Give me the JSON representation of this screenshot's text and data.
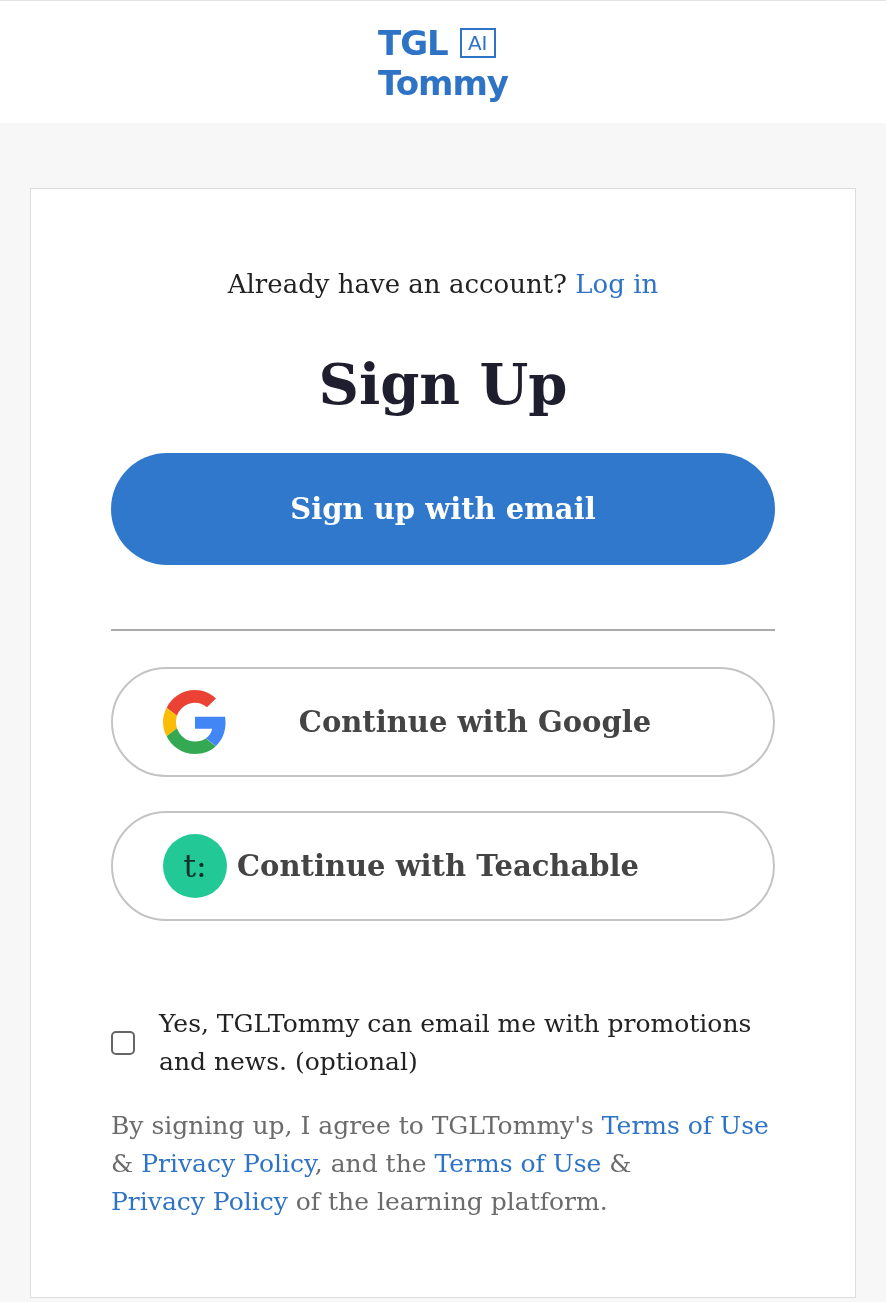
{
  "logo": {
    "line_1": "TGL",
    "chip": "AI",
    "line_2": "Tommy"
  },
  "login_prompt": {
    "text": "Already have an account?",
    "link": "Log in"
  },
  "title": "Sign Up",
  "primary_button": "Sign up with email",
  "providers": [
    {
      "kind": "google",
      "label": "Continue with Google"
    },
    {
      "kind": "teachable",
      "label": "Continue with Teachable",
      "icon_text": "t:"
    }
  ],
  "consent": {
    "checked": false,
    "label": "Yes, TGLTommy can email me with promotions and news. (optional)"
  },
  "legal": [
    {
      "kind": "text",
      "text": "By signing up, I agree to TGLTommy's "
    },
    {
      "kind": "link",
      "text": "Terms of Use"
    },
    {
      "kind": "text",
      "text": " & "
    },
    {
      "kind": "link",
      "text": "Privacy Policy"
    },
    {
      "kind": "text",
      "text": ", and the "
    },
    {
      "kind": "link",
      "text": "Terms of Use"
    },
    {
      "kind": "text",
      "text": " & "
    },
    {
      "kind": "link",
      "text": "Privacy Policy"
    },
    {
      "kind": "text",
      "text": " of the learning platform."
    }
  ]
}
